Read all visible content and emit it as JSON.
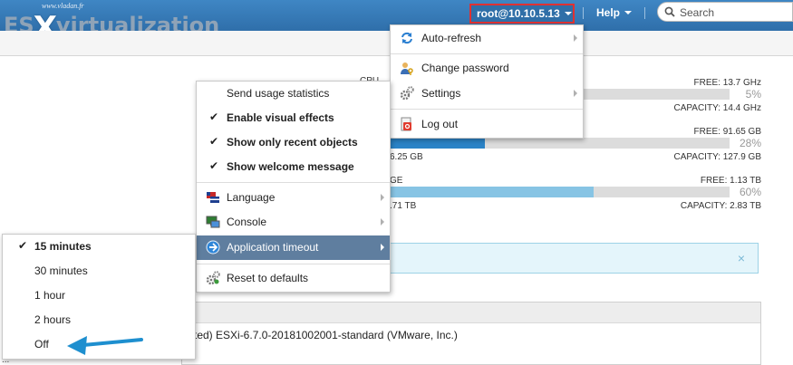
{
  "logo": {
    "site": "www.vladan.fr",
    "pre": "ES",
    "x": "X",
    "post": "virtualization"
  },
  "header": {
    "user": "root@10.10.5.13",
    "help": "Help",
    "search_placeholder": "Search"
  },
  "resources": {
    "cpu": {
      "label": "CPU",
      "free": "FREE: 13.7 GHz",
      "percent": "5%",
      "capacity": "CAPACITY: 14.4 GHz",
      "used_fraction": 0.05
    },
    "memory": {
      "free": "FREE: 91.65 GB",
      "percent": "28%",
      "used": "6.25 GB",
      "capacity": "CAPACITY: 127.9 GB",
      "used_fraction": 0.28
    },
    "storage": {
      "label": "GE",
      "free": "FREE: 1.13 TB",
      "percent": "60%",
      "used": ".71 TB",
      "capacity": "CAPACITY: 2.83 TB",
      "used_fraction": 0.6
    }
  },
  "info_close": "×",
  "version_text": "ted) ESXi-6.7.0-20181002001-standard (VMware, Inc.)",
  "left_fragment": "...",
  "user_menu": {
    "items": [
      {
        "label": "Auto-refresh",
        "icon": "refresh-icon",
        "submenu": true
      },
      {
        "label": "Change password",
        "icon": "user-key-icon",
        "submenu": false
      },
      {
        "label": "Settings",
        "icon": "gears-icon",
        "submenu": true
      },
      {
        "label": "Log out",
        "icon": "logout-icon",
        "submenu": false
      }
    ]
  },
  "settings_menu": {
    "items": [
      {
        "label": "Send usage statistics",
        "checked": false
      },
      {
        "label": "Enable visual effects",
        "checked": true
      },
      {
        "label": "Show only recent objects",
        "checked": true
      },
      {
        "label": "Show welcome message",
        "checked": true
      },
      {
        "label": "Language",
        "icon": "language-flag-icon",
        "submenu": true
      },
      {
        "label": "Console",
        "icon": "console-icon",
        "submenu": true
      },
      {
        "label": "Application timeout",
        "icon": "timeout-icon",
        "submenu": true,
        "active": true
      },
      {
        "label": "Reset to defaults",
        "icon": "reset-gears-icon",
        "submenu": false
      }
    ]
  },
  "timeout_menu": {
    "items": [
      {
        "label": "15 minutes",
        "checked": true
      },
      {
        "label": "30 minutes",
        "checked": false
      },
      {
        "label": "1 hour",
        "checked": false
      },
      {
        "label": "2 hours",
        "checked": false
      },
      {
        "label": "Off",
        "checked": false
      }
    ]
  },
  "check_glyph": "✔",
  "colors": {
    "header": "#3f86c4",
    "active_item": "#5f7e9f",
    "highlight_border": "#e03131",
    "annotation_arrow": "#1e8fcf",
    "memory_bar": "#2b83c6",
    "storage_bar": "#87c4e4"
  }
}
